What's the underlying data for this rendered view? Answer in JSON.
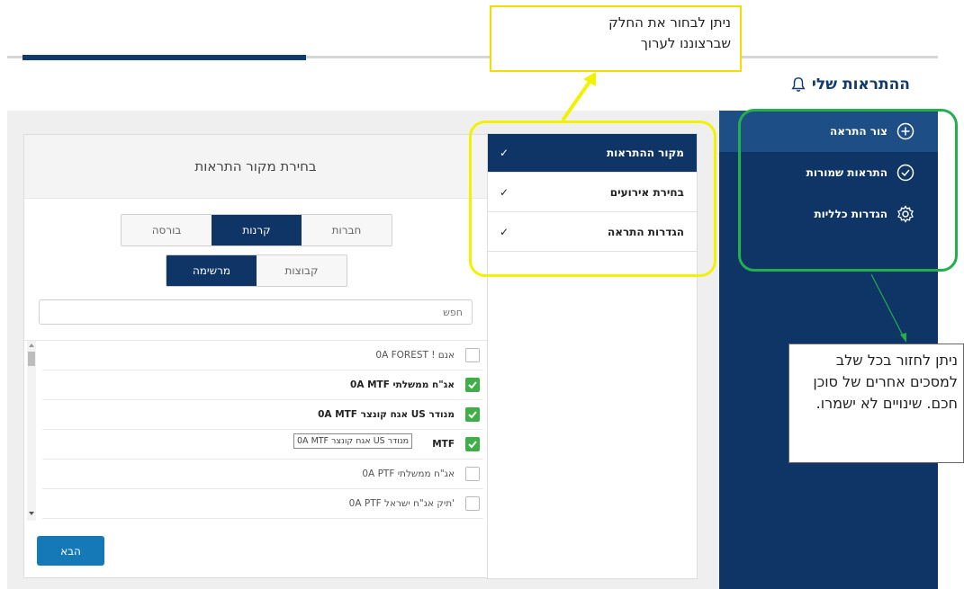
{
  "page": {
    "title": "ההתראות שלי"
  },
  "sidebar": {
    "items": [
      {
        "label": "צור התראה",
        "icon": "plus-circle-icon",
        "active": true
      },
      {
        "label": "התראות שמורות",
        "icon": "check-circle-icon",
        "active": false
      },
      {
        "label": "הגדרות כלליות",
        "icon": "gear-icon",
        "active": false
      }
    ]
  },
  "steps": [
    {
      "label": "מקור ההתראות",
      "check": "✓",
      "active": true
    },
    {
      "label": "בחירת אירועים",
      "check": "✓",
      "active": false
    },
    {
      "label": "הגדרות התראה",
      "check": "✓",
      "active": false
    }
  ],
  "form": {
    "title": "בחירת מקור התראות",
    "source_tabs": [
      "חברות",
      "קרנות",
      "בורסה"
    ],
    "source_active": "קרנות",
    "mode_tabs": [
      "קבוצות",
      "מרשימה"
    ],
    "mode_active": "מרשימה",
    "search_placeholder": "חפש",
    "items": [
      {
        "label": "0A FOREST ! אנם",
        "checked": false
      },
      {
        "label": "0A MTF אג\"ח ממשלתי",
        "checked": true
      },
      {
        "label": "0A MTF אגח קונצר US מנודר",
        "checked": true
      },
      {
        "label": "MTF",
        "checked": true
      },
      {
        "label": "0A PTF אג\"ח ממשלתי",
        "checked": false
      },
      {
        "label": "0A PTF תיק אג\"ח ישראל'",
        "checked": false
      }
    ],
    "tooltip": "0A MTF אגח קונצר US מנודר",
    "next_label": "הבא"
  },
  "annotations": {
    "top_callout_line1": "ניתן לבחור את החלק",
    "top_callout_line2": "שברצוננו לערוך",
    "side_callout": "ניתן לחזור בכל שלב למסכים אחרים של סוכן חכם. שינויים לא ישמרו."
  },
  "colors": {
    "navy": "#0f3566",
    "accent_blue": "#1578b7",
    "check_green": "#3fae49",
    "highlight_yellow": "#f2f200",
    "highlight_green": "#21b04b"
  }
}
